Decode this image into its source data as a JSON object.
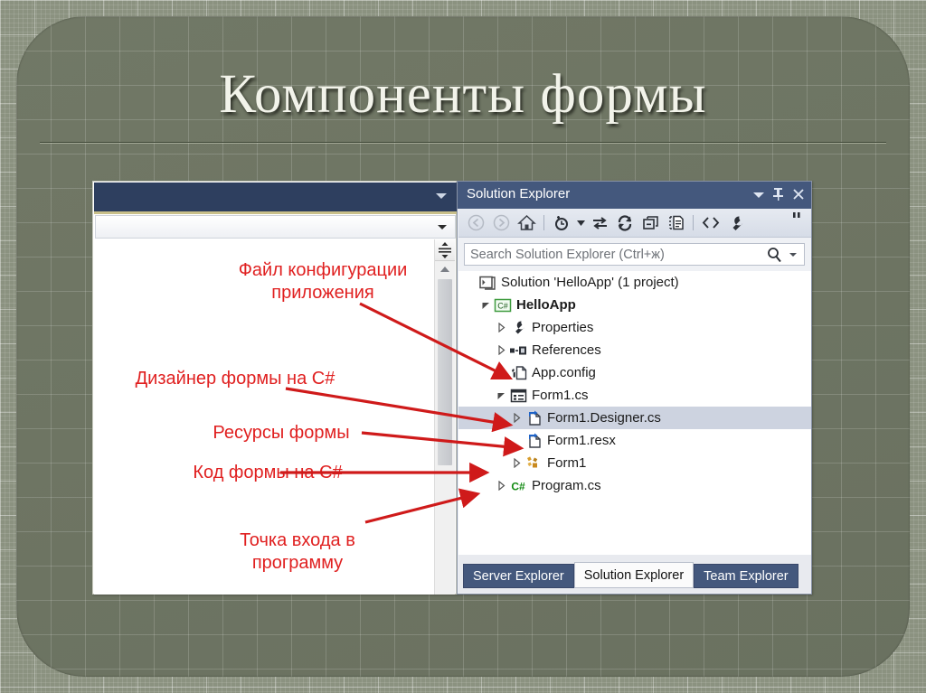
{
  "slide": {
    "title": "Компоненты формы"
  },
  "annotations": [
    {
      "id": "app-config",
      "text": "Файл конфигурации\nприложения"
    },
    {
      "id": "form-designer",
      "text": "Дизайнер формы на C#"
    },
    {
      "id": "form-resources",
      "text": "Ресурсы формы"
    },
    {
      "id": "form-code",
      "text": "Код формы на C#"
    },
    {
      "id": "entry-point",
      "text": "Точка входа в\nпрограмму"
    }
  ],
  "solution_explorer": {
    "title": "Solution Explorer",
    "title_buttons": [
      {
        "name": "dropdown",
        "glyph": "▾"
      },
      {
        "name": "pin",
        "glyph": "📌"
      },
      {
        "name": "close",
        "glyph": "✕"
      }
    ],
    "toolbar": [
      {
        "name": "back-icon",
        "tip": "Back"
      },
      {
        "name": "forward-icon",
        "tip": "Forward"
      },
      {
        "name": "home-icon",
        "tip": "Home"
      },
      {
        "name": "pending-changes-icon",
        "tip": "Pending Changes Filter"
      },
      {
        "name": "sync-icon",
        "tip": "Sync with Active Document"
      },
      {
        "name": "refresh-icon",
        "tip": "Refresh"
      },
      {
        "name": "collapse-all-icon",
        "tip": "Collapse All"
      },
      {
        "name": "show-all-files-icon",
        "tip": "Show All Files"
      },
      {
        "name": "view-code-icon",
        "tip": "View Code"
      },
      {
        "name": "properties-icon",
        "tip": "Properties"
      },
      {
        "name": "overflow-icon",
        "tip": "More"
      }
    ],
    "search": {
      "placeholder": "Search Solution Explorer (Ctrl+ж)",
      "value": ""
    },
    "tree": [
      {
        "label": "Solution 'HelloApp' (1 project)",
        "indent": 0,
        "expander": "none",
        "icon": "solution-icon",
        "bold": false,
        "selected": false
      },
      {
        "label": "HelloApp",
        "indent": 1,
        "expander": "expanded",
        "icon": "csharp-project-icon",
        "bold": true,
        "selected": false
      },
      {
        "label": "Properties",
        "indent": 2,
        "expander": "collapsed",
        "icon": "wrench-icon",
        "bold": false,
        "selected": false
      },
      {
        "label": "References",
        "indent": 2,
        "expander": "collapsed",
        "icon": "references-icon",
        "bold": false,
        "selected": false
      },
      {
        "label": "App.config",
        "indent": 2,
        "expander": "none",
        "icon": "config-file-icon",
        "bold": false,
        "selected": false
      },
      {
        "label": "Form1.cs",
        "indent": 2,
        "expander": "expanded",
        "icon": "form-icon",
        "bold": false,
        "selected": false
      },
      {
        "label": "Form1.Designer.cs",
        "indent": 3,
        "expander": "collapsed",
        "icon": "designer-file-icon",
        "bold": false,
        "selected": true
      },
      {
        "label": "Form1.resx",
        "indent": 3,
        "expander": "none",
        "icon": "resx-file-icon",
        "bold": false,
        "selected": false
      },
      {
        "label": "Form1",
        "indent": 3,
        "expander": "collapsed",
        "icon": "component-icon",
        "bold": false,
        "selected": false
      },
      {
        "label": "Program.cs",
        "indent": 2,
        "expander": "collapsed",
        "icon": "csharp-file-icon",
        "bold": false,
        "selected": false
      }
    ],
    "tabs": [
      {
        "label": "Server Explorer",
        "active": false
      },
      {
        "label": "Solution Explorer",
        "active": true
      },
      {
        "label": "Team Explorer",
        "active": false
      }
    ]
  },
  "colors": {
    "slide_background": "#8b9280",
    "panel_background": "#6e7563",
    "title_text": "#f2f3ea",
    "annotation_red": "#e02020",
    "vs_title_blue": "#44587d",
    "editor_title_navy": "#2e3f5f",
    "selection_blue": "#cdd3e0"
  }
}
